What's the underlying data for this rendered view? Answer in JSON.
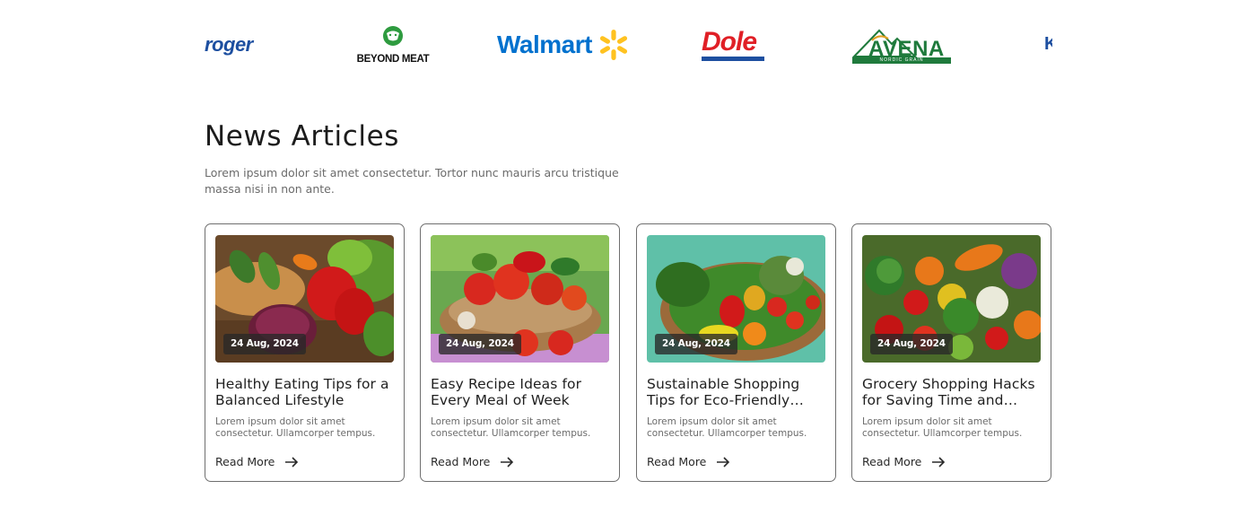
{
  "brands": [
    {
      "name": "kroger",
      "text": "roger"
    },
    {
      "name": "beyond-meat",
      "text": "BEYOND MEAT"
    },
    {
      "name": "walmart",
      "text": "Walmart"
    },
    {
      "name": "dole",
      "text": "Dole"
    },
    {
      "name": "avena",
      "text": "AVENA",
      "sub": "NORDIC GRAIN"
    },
    {
      "name": "partial",
      "text": "K"
    }
  ],
  "section": {
    "title": "News Articles",
    "description": "Lorem ipsum dolor sit amet consectetur. Tortor nunc mauris arcu tristique massa nisi in non ante."
  },
  "articles": [
    {
      "date": "24 Aug, 2024",
      "title": "Healthy Eating Tips for a Balanced Lifestyle",
      "excerpt": "Lorem ipsum dolor sit amet consectetur. Ullamcorper tempus.",
      "cta": "Read More"
    },
    {
      "date": "24 Aug, 2024",
      "title": "Easy Recipe Ideas for Every Meal of Week",
      "excerpt": "Lorem ipsum dolor sit amet consectetur. Ullamcorper tempus.",
      "cta": "Read More"
    },
    {
      "date": "24 Aug, 2024",
      "title": "Sustainable Shopping Tips for Eco-Friendly Choices",
      "excerpt": "Lorem ipsum dolor sit amet consectetur. Ullamcorper tempus.",
      "cta": "Read More"
    },
    {
      "date": "24 Aug, 2024",
      "title": "Grocery Shopping Hacks for Saving Time and Money",
      "excerpt": "Lorem ipsum dolor sit amet consectetur. Ullamcorper tempus.",
      "cta": "Read More"
    }
  ],
  "colors": {
    "walmart_blue": "#0071ce",
    "walmart_yellow": "#ffc220",
    "dole_red": "#e01f26",
    "avena_green": "#1f7a3c",
    "card_border": "#6f6f6f"
  }
}
